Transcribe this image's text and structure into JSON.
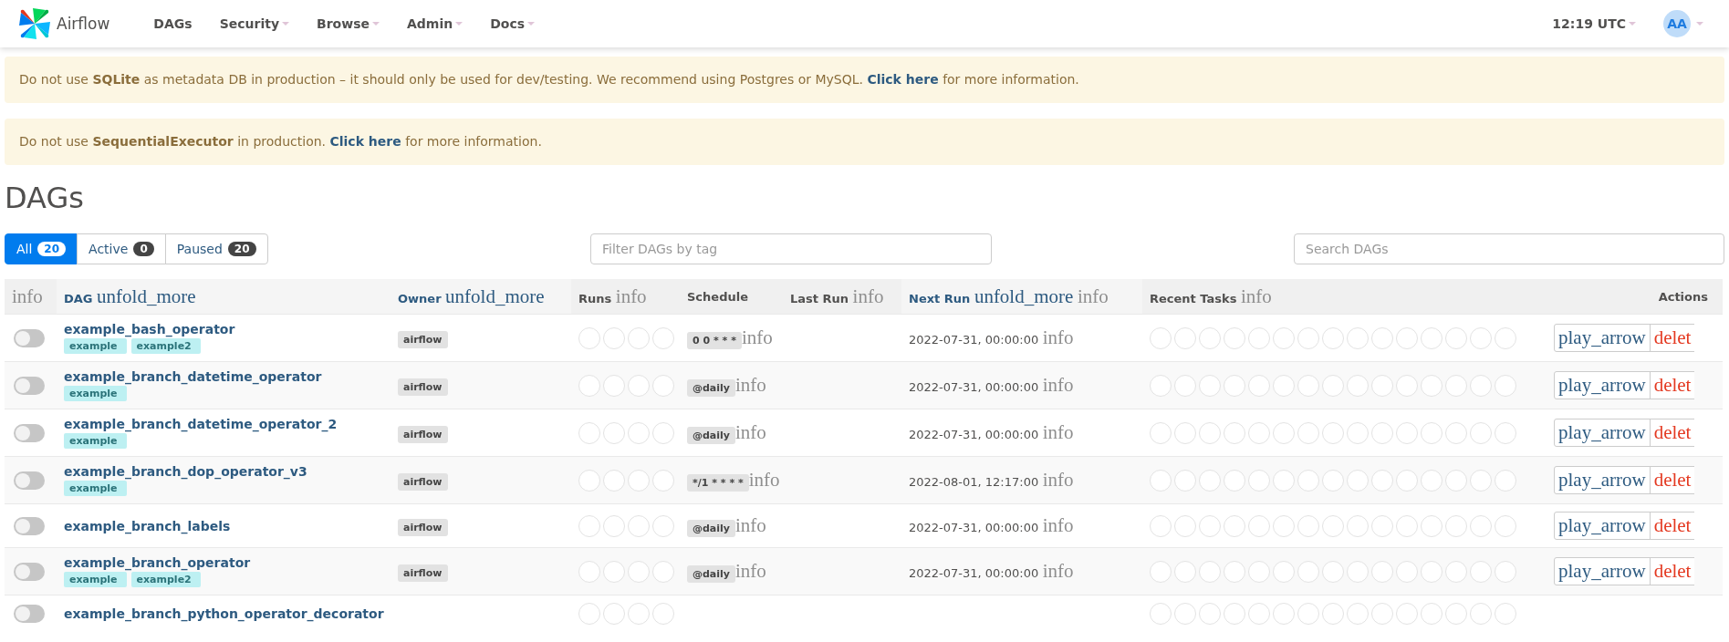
{
  "brand": {
    "name": "Airflow"
  },
  "nav": [
    {
      "label": "DAGs",
      "dropdown": false
    },
    {
      "label": "Security",
      "dropdown": true
    },
    {
      "label": "Browse",
      "dropdown": true
    },
    {
      "label": "Admin",
      "dropdown": true
    },
    {
      "label": "Docs",
      "dropdown": true
    }
  ],
  "clock": {
    "label": "12:19 UTC"
  },
  "user": {
    "initials": "AA"
  },
  "alerts": [
    {
      "text": "Do not use **SQLite** as metadata DB in production – it should only be used for dev/testing. We recommend using Postgres or MySQL.",
      "link": "Click here",
      "after": "for more information."
    },
    {
      "text": "Do not use **SequentialExecutor** in production.",
      "link": "Click here",
      "after": "for more information."
    }
  ],
  "page_title": "DAGs",
  "filters": [
    {
      "label": "All",
      "count": "20",
      "selected": true
    },
    {
      "label": "Active",
      "count": "0",
      "selected": false
    },
    {
      "label": "Paused",
      "count": "20",
      "selected": false
    }
  ],
  "tag_filter": {
    "placeholder": "Filter DAGs by tag"
  },
  "search": {
    "placeholder": "Search DAGs"
  },
  "table": {
    "columns": [
      {
        "info_icon": "info"
      },
      {
        "label": "DAG",
        "sort_icon": "unfold_more"
      },
      {
        "label": "Owner",
        "sort_icon": "unfold_more"
      },
      {
        "label": "Runs",
        "info_icon": "info"
      },
      {
        "label": "Schedule"
      },
      {
        "label": "Last Run",
        "info_icon": "info"
      },
      {
        "label": "Next Run",
        "sort_icon": "unfold_more",
        "info_icon": "info"
      },
      {
        "label": "Recent Tasks",
        "info_icon": "info"
      },
      {
        "label": "Actions"
      }
    ],
    "rows": [
      {
        "active": false,
        "name": "example_bash_operator",
        "tags": [
          "example",
          "example2"
        ],
        "owner": "airflow",
        "schedule": "0 0 * * *",
        "schedule_info": "info",
        "next_run": "2022-07-31, 00:00:00",
        "next_run_info": "info",
        "actions": [
          "play_arrow",
          "delet"
        ]
      },
      {
        "active": false,
        "name": "example_branch_datetime_operator",
        "tags": [
          "example"
        ],
        "owner": "airflow",
        "schedule": "@daily",
        "schedule_info": "info",
        "next_run": "2022-07-31, 00:00:00",
        "next_run_info": "info",
        "actions": [
          "play_arrow",
          "delet"
        ]
      },
      {
        "active": false,
        "name": "example_branch_datetime_operator_2",
        "tags": [
          "example"
        ],
        "owner": "airflow",
        "schedule": "@daily",
        "schedule_info": "info",
        "next_run": "2022-07-31, 00:00:00",
        "next_run_info": "info",
        "actions": [
          "play_arrow",
          "delet"
        ]
      },
      {
        "active": false,
        "name": "example_branch_dop_operator_v3",
        "tags": [
          "example"
        ],
        "owner": "airflow",
        "schedule": "*/1 * * * *",
        "schedule_info": "info",
        "next_run": "2022-08-01, 12:17:00",
        "next_run_info": "info",
        "actions": [
          "play_arrow",
          "delet"
        ]
      },
      {
        "active": false,
        "name": "example_branch_labels",
        "owner": "airflow",
        "schedule": "@daily",
        "schedule_info": "info",
        "next_run": "2022-07-31, 00:00:00",
        "next_run_info": "info",
        "actions": [
          "play_arrow",
          "delet"
        ]
      },
      {
        "active": false,
        "name": "example_branch_operator",
        "tags": [
          "example",
          "example2"
        ],
        "owner": "airflow",
        "schedule": "@daily",
        "schedule_info": "info",
        "next_run": "2022-07-31, 00:00:00",
        "next_run_info": "info",
        "actions": [
          "play_arrow",
          "delet"
        ]
      },
      {
        "active": false,
        "name": "example_branch_python_operator_decorator"
      }
    ]
  }
}
